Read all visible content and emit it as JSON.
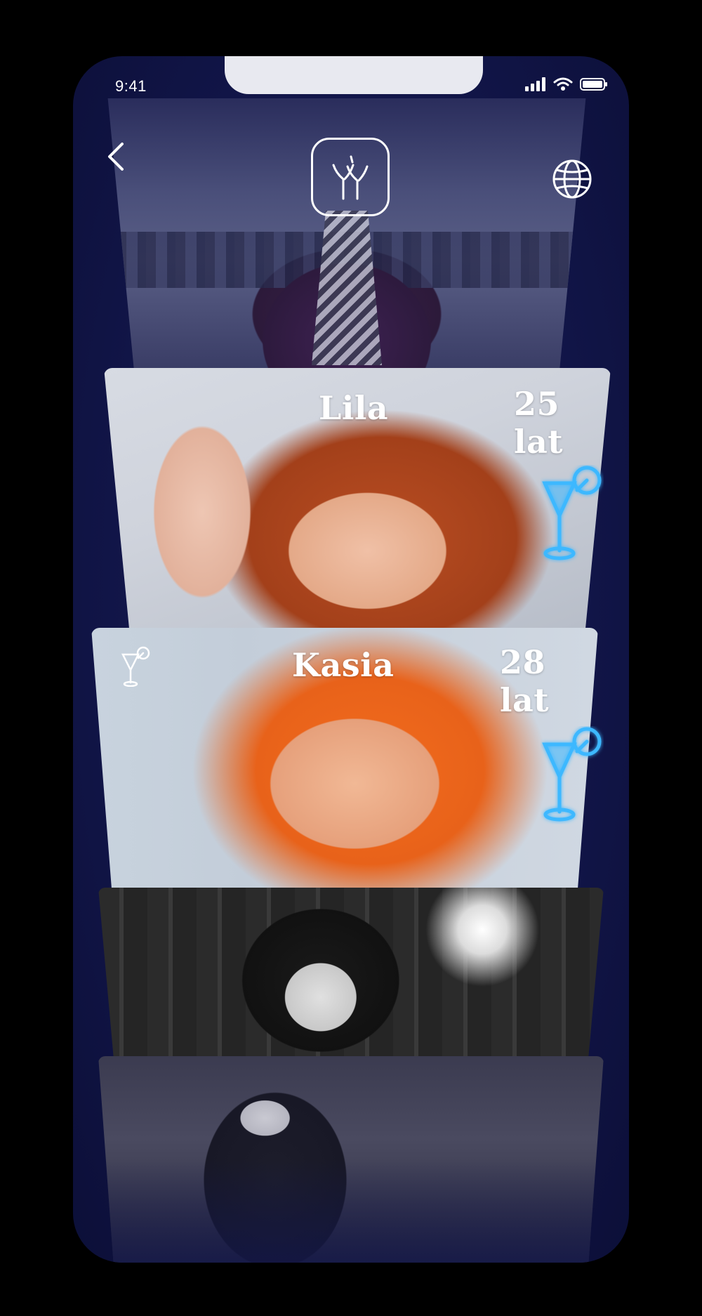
{
  "status_bar": {
    "time": "9:41",
    "icons": [
      "cellular-signal-icon",
      "wifi-icon",
      "battery-icon"
    ]
  },
  "header": {
    "back_icon": "chevron-left-icon",
    "logo_icon": "app-logo-icon",
    "globe_icon": "globe-icon"
  },
  "profiles": [
    {
      "name": "Lila",
      "age": "25 lat",
      "drink_icon": "cocktail-glass-icon-neon"
    },
    {
      "name": "Kasia",
      "age": "28 lat",
      "drink_icon": "cocktail-glass-icon-neon",
      "badge_icon": "cocktail-glass-icon-small"
    }
  ],
  "colors": {
    "background": "#12164a",
    "neon": "#3cb8ff",
    "text": "#ffffff",
    "notch": "#e8e9f0"
  }
}
